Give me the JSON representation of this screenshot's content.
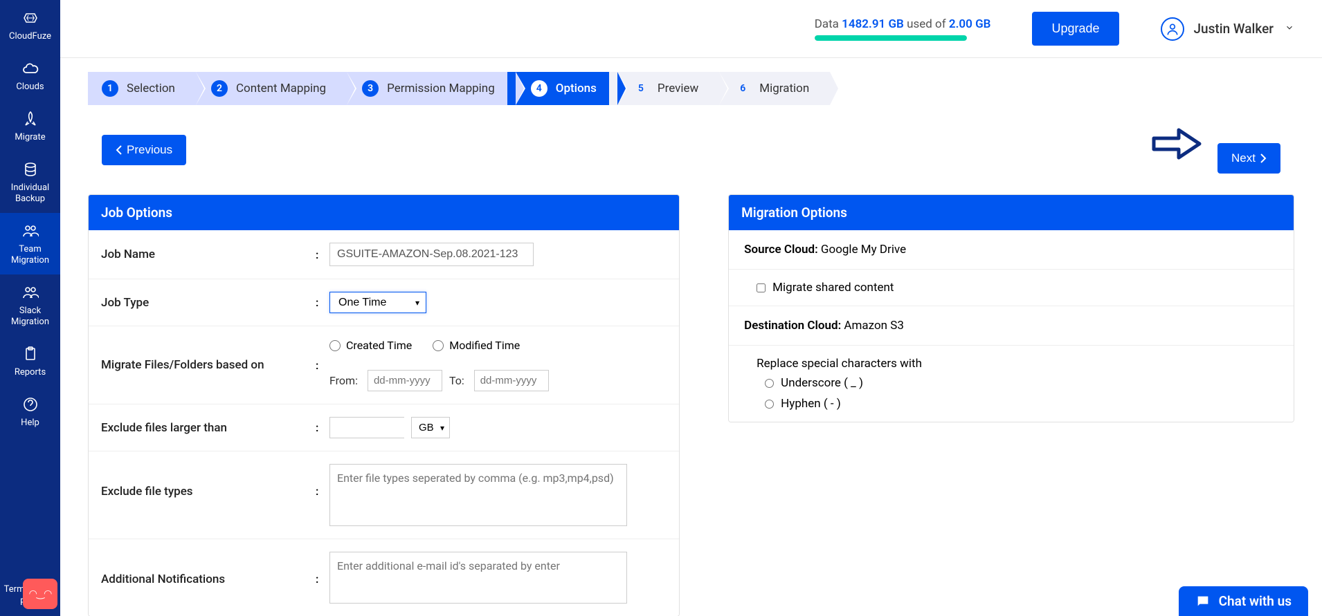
{
  "sidebar": {
    "items": [
      {
        "label": "CloudFuze"
      },
      {
        "label": "Clouds"
      },
      {
        "label": "Migrate"
      },
      {
        "label": "Individual Backup"
      },
      {
        "label": "Team Migration"
      },
      {
        "label": "Slack Migration"
      },
      {
        "label": "Reports"
      },
      {
        "label": "Help"
      }
    ],
    "footer": {
      "terms": "Terms of use",
      "privacy": "Priva"
    }
  },
  "header": {
    "data_prefix": "Data ",
    "data_used": "1482.91 GB",
    "data_mid": " used of ",
    "data_total": "2.00 GB",
    "upgrade": "Upgrade",
    "user_name": "Justin Walker"
  },
  "stepper": [
    {
      "num": "1",
      "label": "Selection",
      "state": "completed"
    },
    {
      "num": "2",
      "label": "Content Mapping",
      "state": "completed"
    },
    {
      "num": "3",
      "label": "Permission Mapping",
      "state": "completed"
    },
    {
      "num": "4",
      "label": "Options",
      "state": "active"
    },
    {
      "num": "5",
      "label": "Preview",
      "state": "upcoming"
    },
    {
      "num": "6",
      "label": "Migration",
      "state": "upcoming"
    }
  ],
  "nav": {
    "previous": "Previous",
    "next": "Next"
  },
  "job_options": {
    "title": "Job Options",
    "job_name_label": "Job Name",
    "job_name_value": "GSUITE-AMAZON-Sep.08.2021-123",
    "job_type_label": "Job Type",
    "job_type_value": "One Time",
    "migrate_based_label": "Migrate Files/Folders based on",
    "created_time": "Created Time",
    "modified_time": "Modified Time",
    "from_label": "From:",
    "to_label": "To:",
    "date_placeholder": "dd-mm-yyyy",
    "exclude_larger_label": "Exclude files larger than",
    "size_unit": "GB",
    "exclude_types_label": "Exclude file types",
    "exclude_types_placeholder": "Enter file types seperated by comma (e.g. mp3,mp4,psd)",
    "notifications_label": "Additional Notifications",
    "notifications_placeholder": "Enter additional e-mail id's separated by enter"
  },
  "migration_options": {
    "title": "Migration Options",
    "source_label": "Source Cloud:",
    "source_value": " Google My Drive",
    "migrate_shared": "Migrate shared content",
    "dest_label": "Destination Cloud:",
    "dest_value": " Amazon S3",
    "replace_label": "Replace special characters with",
    "underscore": "Underscore ( _ )",
    "hyphen": "Hyphen ( - )"
  },
  "chat": {
    "label": "Chat with us"
  }
}
